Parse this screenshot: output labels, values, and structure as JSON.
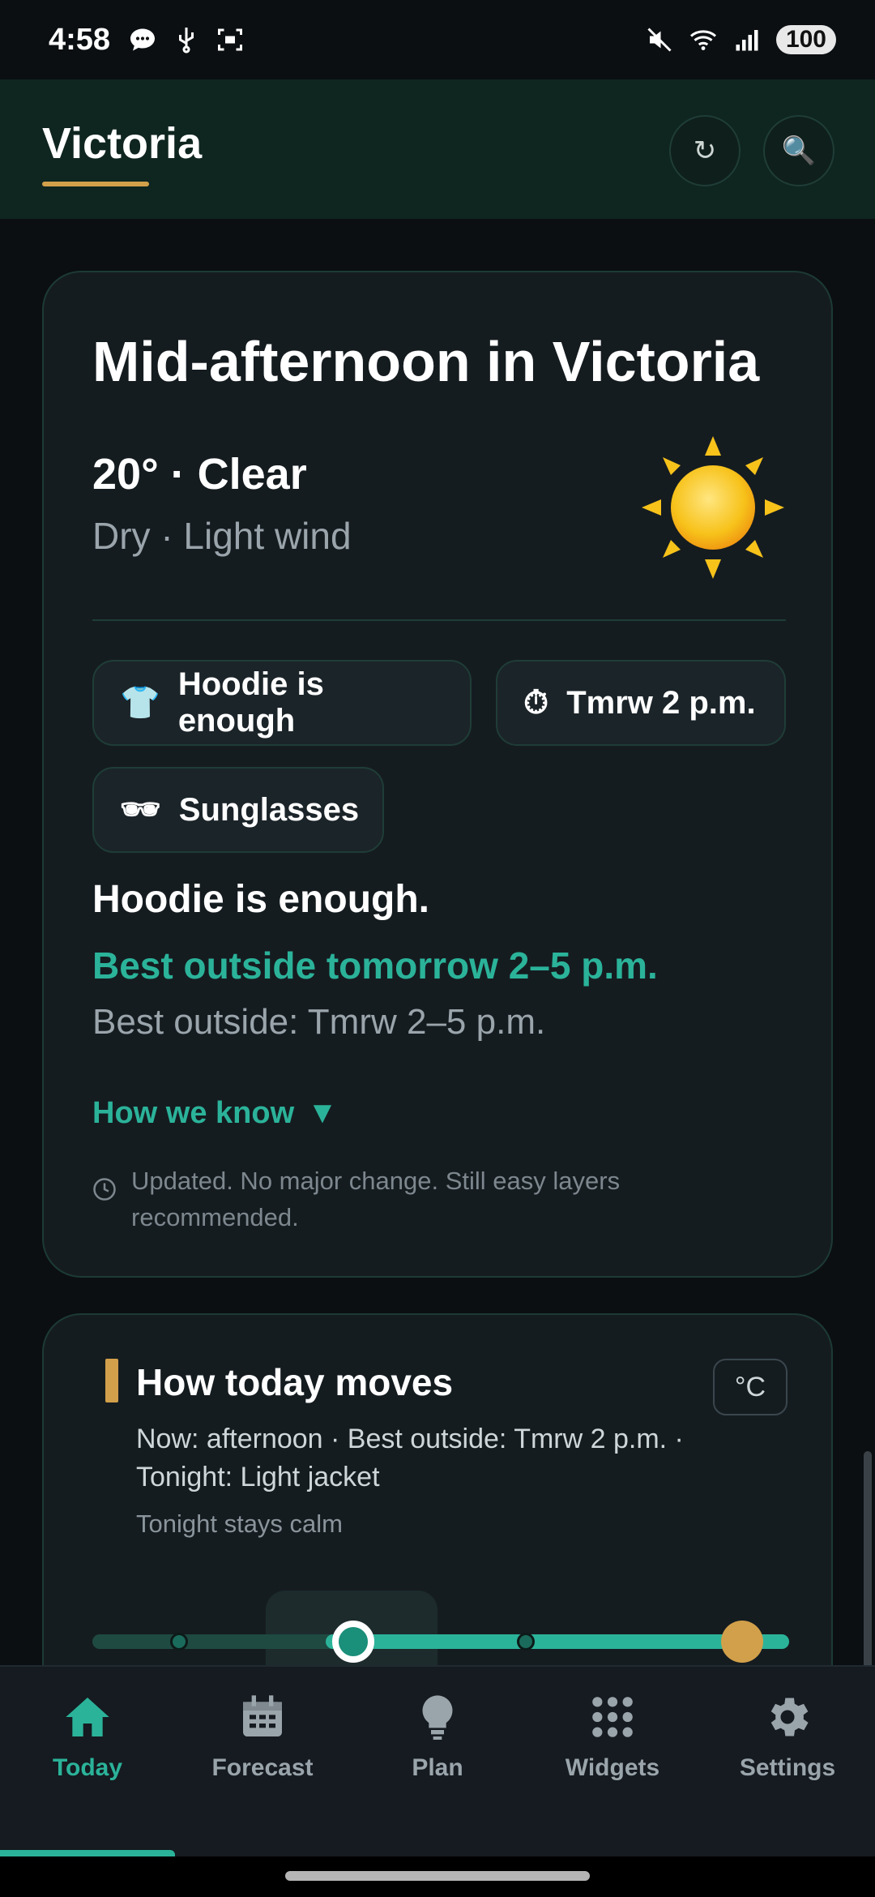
{
  "status_bar": {
    "time": "4:58",
    "battery": "100"
  },
  "header": {
    "city": "Victoria",
    "refresh_icon": "↻",
    "search_icon": "🔍"
  },
  "now_card": {
    "headline": "Mid-afternoon in Victoria",
    "temp_condition": "20° · Clear",
    "sub_condition": "Dry · Light wind",
    "weather_icon": "sun-icon",
    "chips": [
      {
        "icon": "👕",
        "label": "Hoodie is enough"
      },
      {
        "icon": "⏱",
        "label": "Tmrw 2 p.m."
      },
      {
        "icon": "🕶",
        "label": "Sunglasses"
      }
    ],
    "advice": "Hoodie is enough.",
    "best_outside_highlight": "Best outside tomorrow 2–5 p.m.",
    "best_outside_detail": "Best outside: Tmrw 2–5 p.m.",
    "how_we_know": "How we know",
    "how_we_know_arrow": "▼",
    "updated_note": "Updated. No major change. Still easy layers recommended."
  },
  "moves_card": {
    "title": "How today moves",
    "unit": "°C",
    "summary": "Now: afternoon · Best outside: Tmrw 2 p.m. · Tonight: Light jacket",
    "note": "Tonight stays calm"
  },
  "bottom_nav": {
    "items": [
      {
        "label": "Today",
        "icon": "home-icon",
        "active": true
      },
      {
        "label": "Forecast",
        "icon": "calendar-icon",
        "active": false
      },
      {
        "label": "Plan",
        "icon": "lightbulb-icon",
        "active": false
      },
      {
        "label": "Widgets",
        "icon": "grid-icon",
        "active": false
      },
      {
        "label": "Settings",
        "icon": "gear-icon",
        "active": false
      }
    ]
  },
  "colors": {
    "accent": "#2bb39a",
    "gold": "#d2a04a",
    "background": "#0b0f12"
  }
}
